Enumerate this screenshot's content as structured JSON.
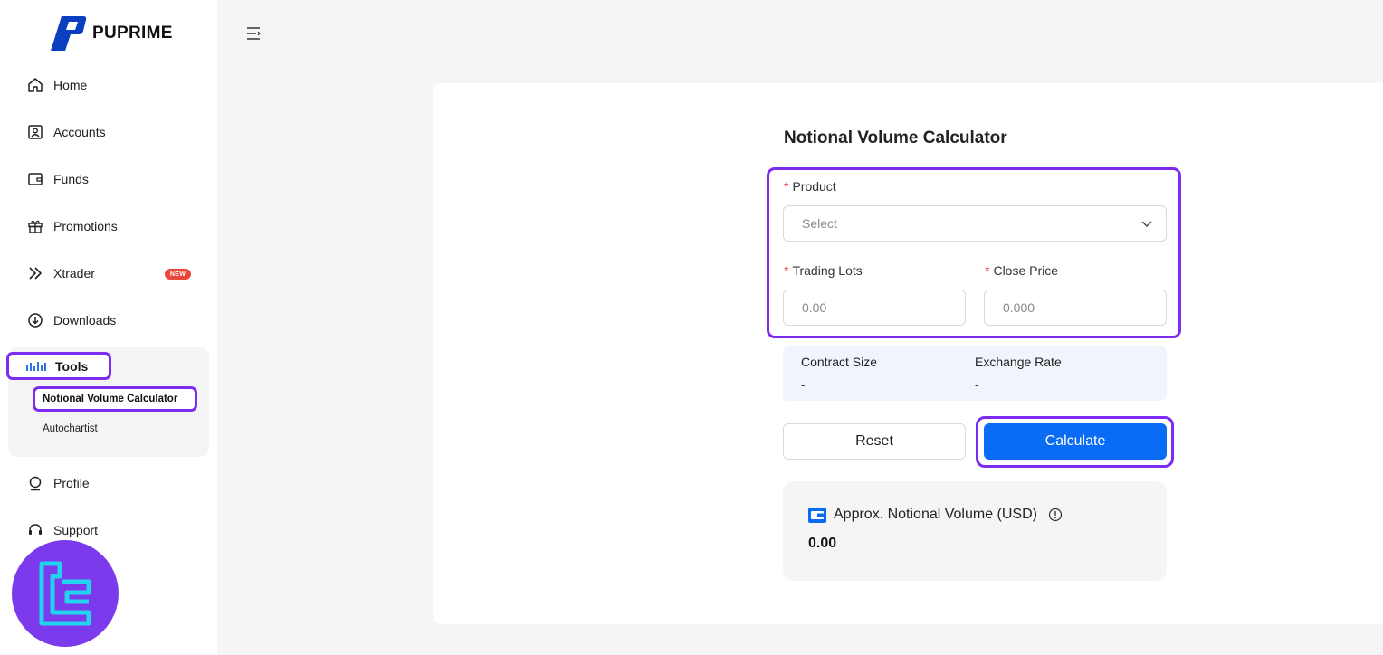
{
  "brand": {
    "name": "PUPRIME",
    "color": "#0a3fbf"
  },
  "sidebar": {
    "items": [
      {
        "label": "Home",
        "icon": "home-icon"
      },
      {
        "label": "Accounts",
        "icon": "account-icon"
      },
      {
        "label": "Funds",
        "icon": "wallet-icon"
      },
      {
        "label": "Promotions",
        "icon": "gift-icon"
      },
      {
        "label": "Xtrader",
        "icon": "double-chevron-icon",
        "badge": "NEW"
      },
      {
        "label": "Downloads",
        "icon": "download-icon"
      },
      {
        "label": "Tools",
        "icon": "bars-icon",
        "active": true
      },
      {
        "label": "Profile",
        "icon": "profile-icon"
      },
      {
        "label": "Support",
        "icon": "headset-icon"
      }
    ],
    "tools_sub": [
      {
        "label": "Notional Volume Calculator",
        "active": true
      },
      {
        "label": "Autochartist"
      }
    ]
  },
  "calculator": {
    "title": "Notional Volume Calculator",
    "product": {
      "label": "Product",
      "placeholder": "Select"
    },
    "lots": {
      "label": "Trading Lots",
      "placeholder": "0.00"
    },
    "price": {
      "label": "Close Price",
      "placeholder": "0.000"
    },
    "contract_size": {
      "label": "Contract Size",
      "value": "-"
    },
    "exchange_rate": {
      "label": "Exchange Rate",
      "value": "-"
    },
    "reset_label": "Reset",
    "calculate_label": "Calculate",
    "result": {
      "label": "Approx. Notional Volume (USD)",
      "value": "0.00"
    }
  },
  "colors": {
    "accent": "#0a6cf5",
    "highlight": "#7b2cf0",
    "required": "#e5484d",
    "badge": "#e9473b"
  }
}
